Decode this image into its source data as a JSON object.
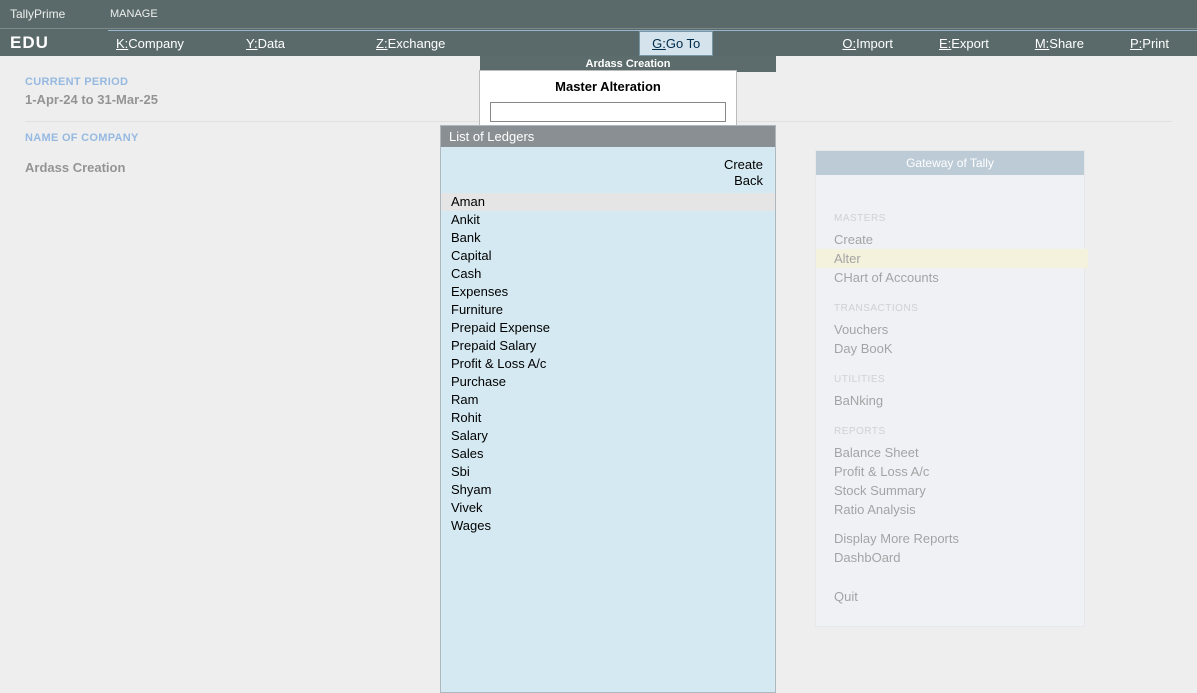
{
  "brand": {
    "line1": "TallyPrime",
    "line2": "EDU",
    "manage": "MANAGE"
  },
  "menu": {
    "company_k": "K:",
    "company": "Company",
    "data_k": "Y:",
    "data": "Data",
    "exchange_k": "Z:",
    "exchange": "Exchange",
    "goto_k": "G:",
    "goto": "Go To",
    "import_k": "O:",
    "import": "Import",
    "export_k": "E:",
    "export": "Export",
    "share_k": "M:",
    "share": "Share",
    "print_k": "P:",
    "print": "Print"
  },
  "bg": {
    "period_label": "CURRENT PERIOD",
    "period_value": "1-Apr-24 to 31-Mar-25",
    "company_label": "NAME OF COMPANY",
    "company_value": "Ardass Creation"
  },
  "gateway": {
    "title": "Gateway of Tally",
    "s_masters": "MASTERS",
    "masters": {
      "create": "Create",
      "alter": "Alter",
      "chart": "CHart of Accounts"
    },
    "s_trans": "TRANSACTIONS",
    "trans": {
      "vouchers": "Vouchers",
      "daybook": "Day BooK"
    },
    "s_utils": "UTILITIES",
    "utils": {
      "banking": "BaNking"
    },
    "s_reports": "REPORTS",
    "reports": {
      "bs": "Balance Sheet",
      "pl": "Profit & Loss A/c",
      "stock": "Stock Summary",
      "ratio": "Ratio Analysis",
      "more": "Display More Reports",
      "dash": "DashbOard"
    },
    "quit": "Quit"
  },
  "popup": {
    "company_bar": "Ardass Creation",
    "master_title": "Master Alteration",
    "input_value": "",
    "list_head": "List of Ledgers",
    "actions": {
      "create": "Create",
      "back": "Back"
    },
    "ledgers": [
      "Aman",
      "Ankit",
      "Bank",
      "Capital",
      "Cash",
      "Expenses",
      "Furniture",
      "Prepaid Expense",
      "Prepaid Salary",
      "Profit & Loss A/c",
      "Purchase",
      "Ram",
      "Rohit",
      "Salary",
      "Sales",
      "Sbi",
      "Shyam",
      "Vivek",
      "Wages"
    ]
  }
}
